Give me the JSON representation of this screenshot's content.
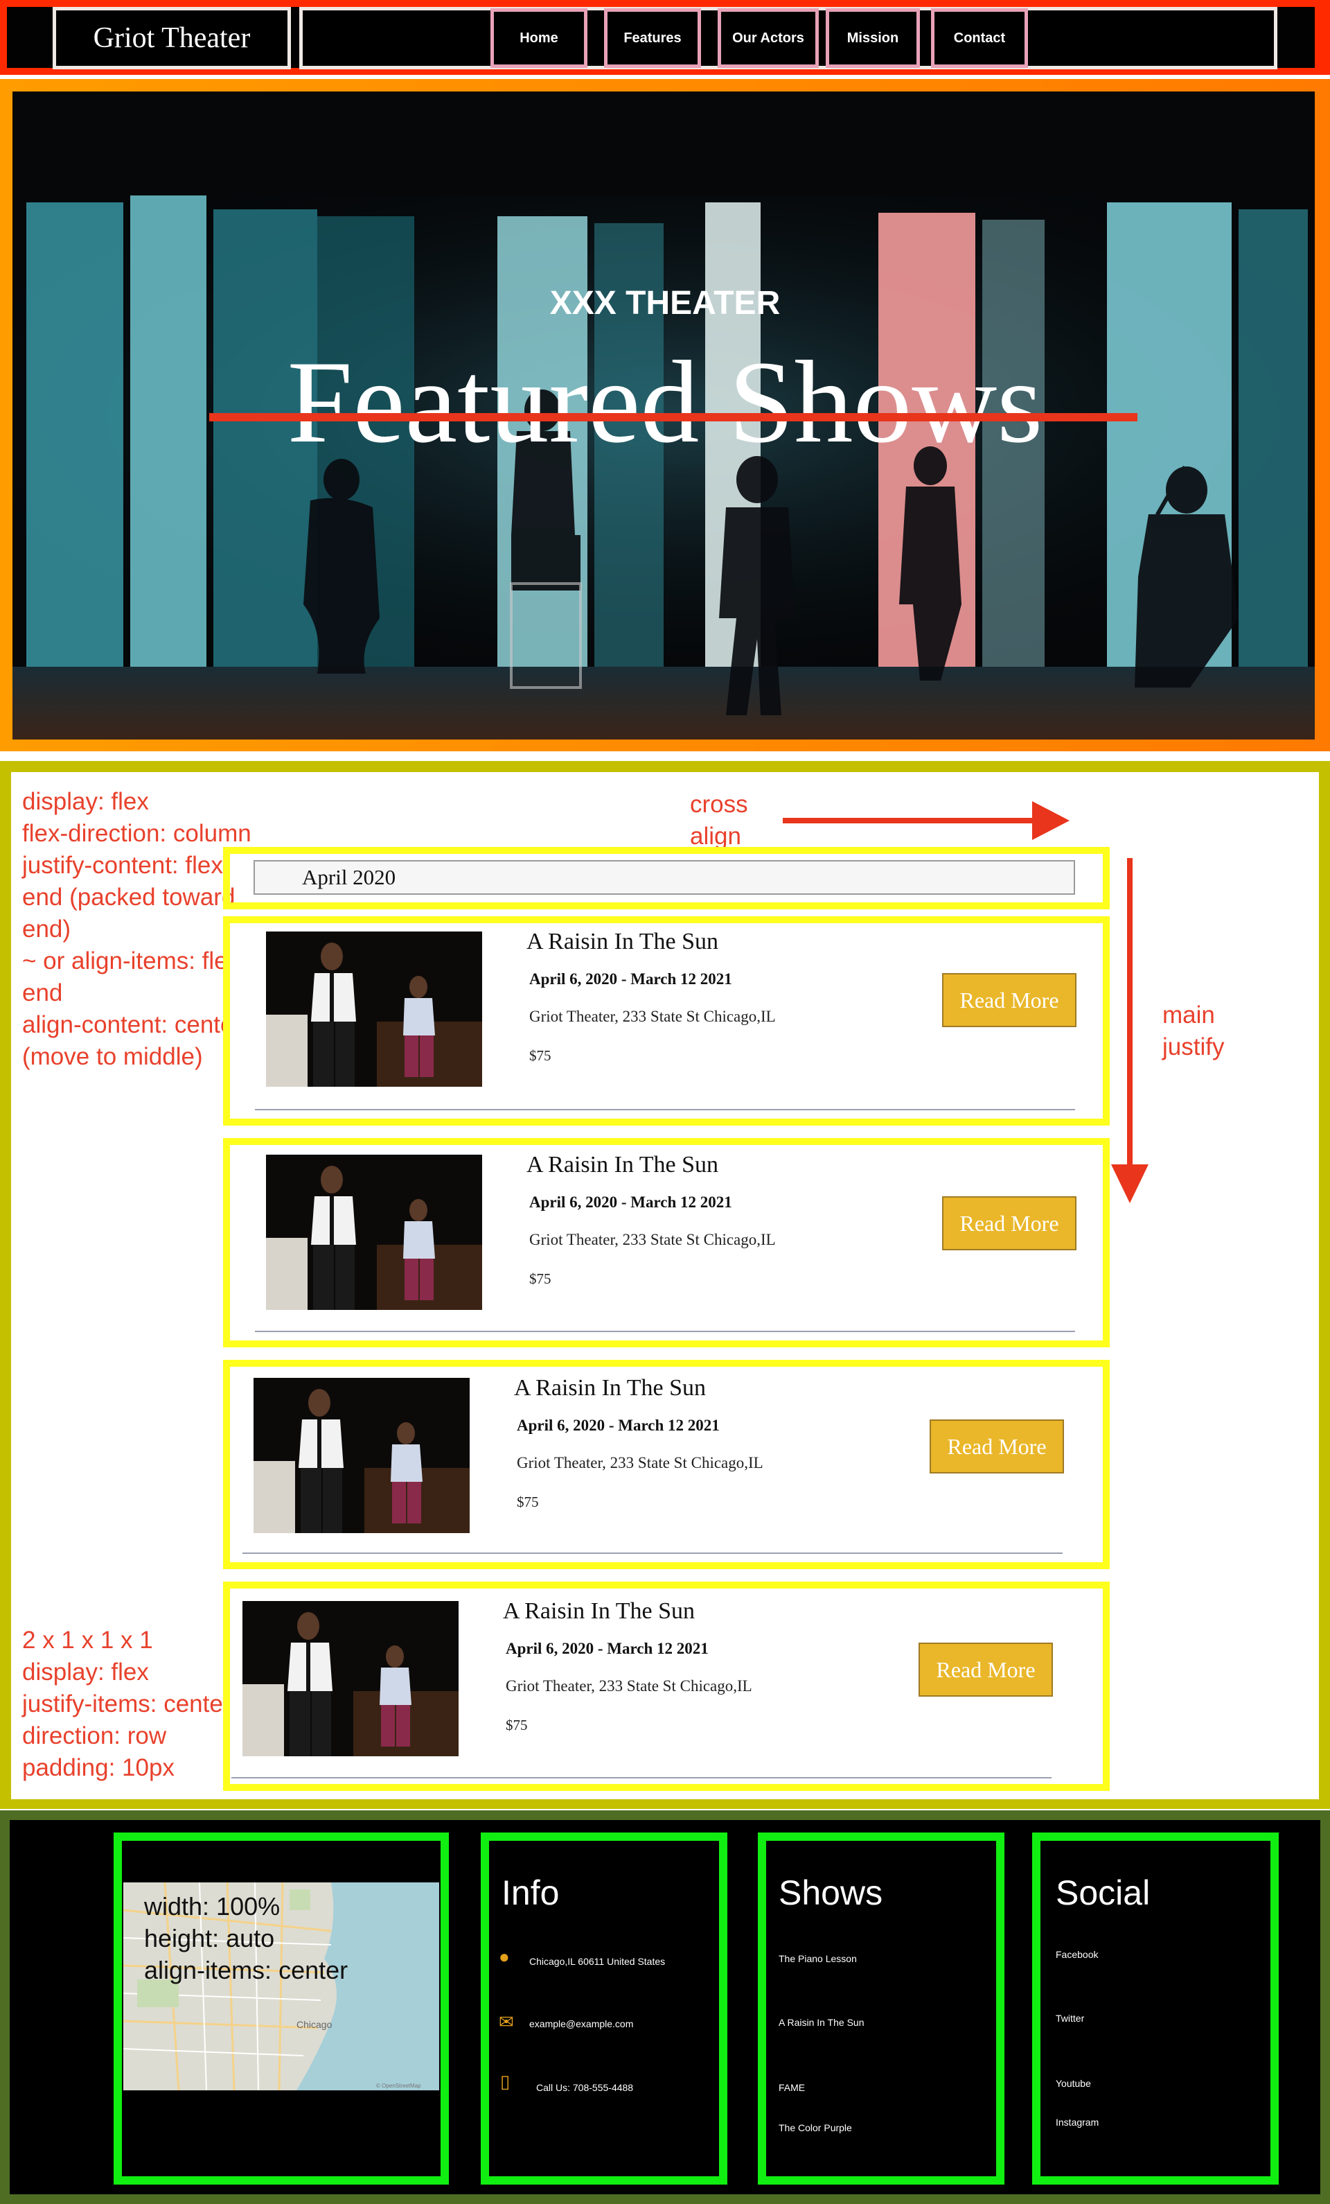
{
  "header": {
    "logo": "Griot Theater",
    "nav": [
      "Home",
      "Features",
      "Our Actors",
      "Mission",
      "Contact"
    ]
  },
  "hero": {
    "subtitle": "XXX THEATER",
    "title": "Featured Shows"
  },
  "annotations": {
    "flex_notes": [
      "display: flex",
      "flex-direction: column",
      "justify-content: flex-",
      "end (packed toward",
      "end)",
      "~ or align-items: flex-",
      "end",
      "align-content: center",
      "(move to middle)"
    ],
    "cross_align": [
      "cross",
      "align"
    ],
    "main_justify": [
      "main",
      "justify"
    ],
    "card_notes": [
      "2 x 1 x 1 x 1",
      "display: flex",
      "justify-items: center",
      "direction: row",
      "padding: 10px"
    ],
    "map_notes": [
      "width: 100%",
      "height: auto",
      "align-items: center"
    ]
  },
  "listing": {
    "month": "April 2020",
    "shows": [
      {
        "title": "A Raisin In The Sun",
        "dates": "April 6, 2020 - March 12 2021",
        "venue": "Griot Theater, 233 State St Chicago,IL",
        "price": "$75",
        "button": "Read More"
      },
      {
        "title": "A Raisin In The Sun",
        "dates": "April 6, 2020 - March 12 2021",
        "venue": "Griot Theater, 233 State St Chicago,IL",
        "price": "$75",
        "button": "Read More"
      },
      {
        "title": "A Raisin In The Sun",
        "dates": "April 6, 2020 - March 12 2021",
        "venue": "Griot Theater, 233 State St Chicago,IL",
        "price": "$75",
        "button": "Read More"
      },
      {
        "title": "A Raisin In The Sun",
        "dates": "April 6, 2020 - March 12 2021",
        "venue": "Griot Theater, 233 State St Chicago,IL",
        "price": "$75",
        "button": "Read More"
      }
    ]
  },
  "footer": {
    "map": {
      "city_label": "Chicago",
      "attribution": "© OpenStreetMap"
    },
    "info": {
      "heading": "Info",
      "address": "Chicago,IL 60611 United States",
      "email": "example@example.com",
      "phone": "Call Us: 708-555-4488",
      "icons": [
        "location-pin-icon",
        "envelope-icon",
        "phone-icon"
      ]
    },
    "shows": {
      "heading": "Shows",
      "links": [
        "The Piano Lesson",
        "A Raisin In The Sun",
        "FAME",
        "The Color Purple"
      ]
    },
    "social": {
      "heading": "Social",
      "links": [
        "Facebook",
        "Twitter",
        "Youtube",
        "Instagram"
      ]
    }
  },
  "colors": {
    "header_frame": "#ff2a00",
    "hero_frame": "#ff8c00",
    "main_frame": "#c4c000",
    "card_border": "#ffff1e",
    "footer_frame": "#4f6e24",
    "footer_column_border": "#11ee11",
    "button": "#eab72a",
    "annotation_red": "#e8412c"
  }
}
